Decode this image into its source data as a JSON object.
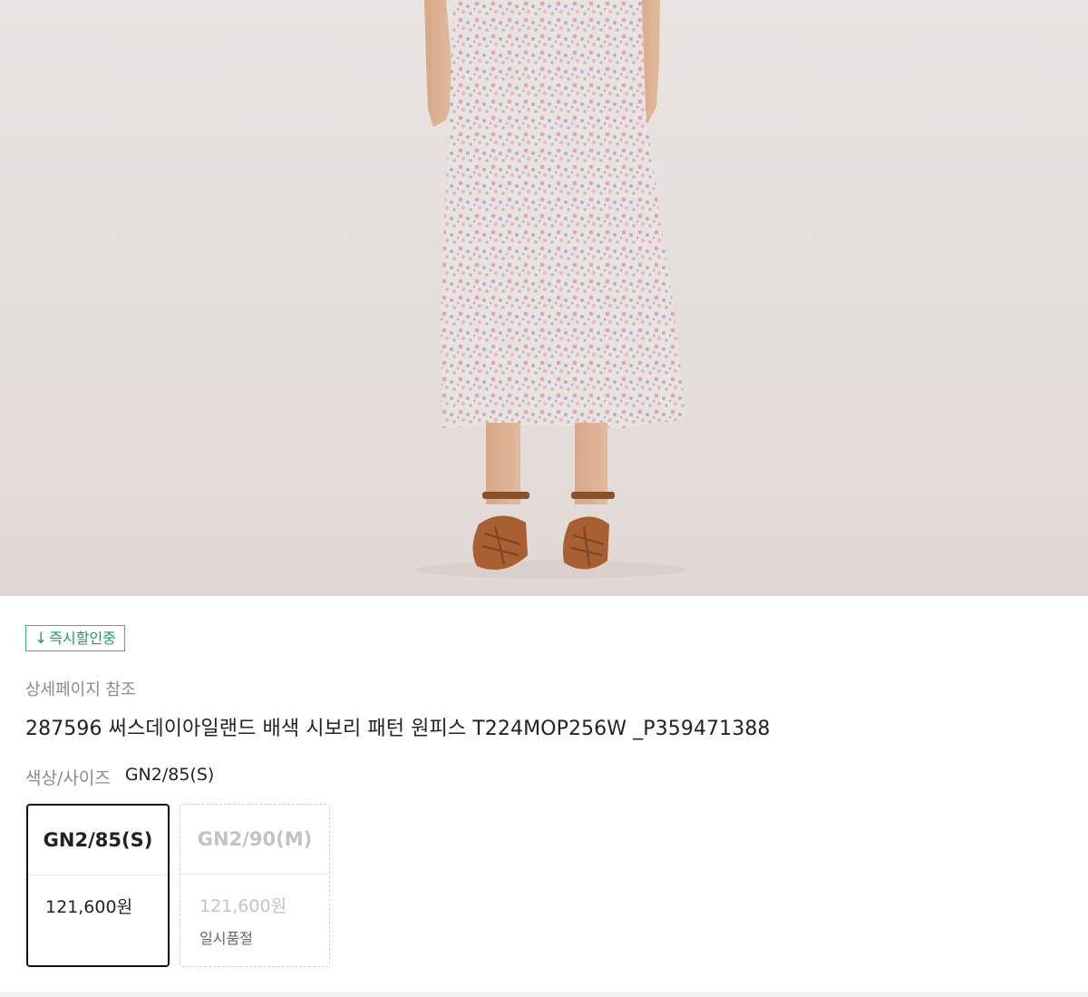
{
  "product_image": {
    "description_icon": "product-photo"
  },
  "badge": {
    "icon": "down-arrow-icon",
    "arrow": "↓",
    "label": "즉시할인중"
  },
  "reference_text": "상세페이지 참조",
  "product_title": "287596 써스데이아일랜드 배색 시보리 패턴 원피스 T224MOP256W _P359471388",
  "option": {
    "label": "색상/사이즈",
    "selected_value": "GN2/85(S)"
  },
  "options": [
    {
      "size": "GN2/85(S)",
      "price": "121,600원",
      "status": ""
    },
    {
      "size": "GN2/90(M)",
      "price": "121,600원",
      "status": "일시품절"
    }
  ],
  "colors": {
    "badge_green": "#1e9e5f",
    "selected_border": "#111111",
    "disabled_text": "#c3c3c3"
  }
}
